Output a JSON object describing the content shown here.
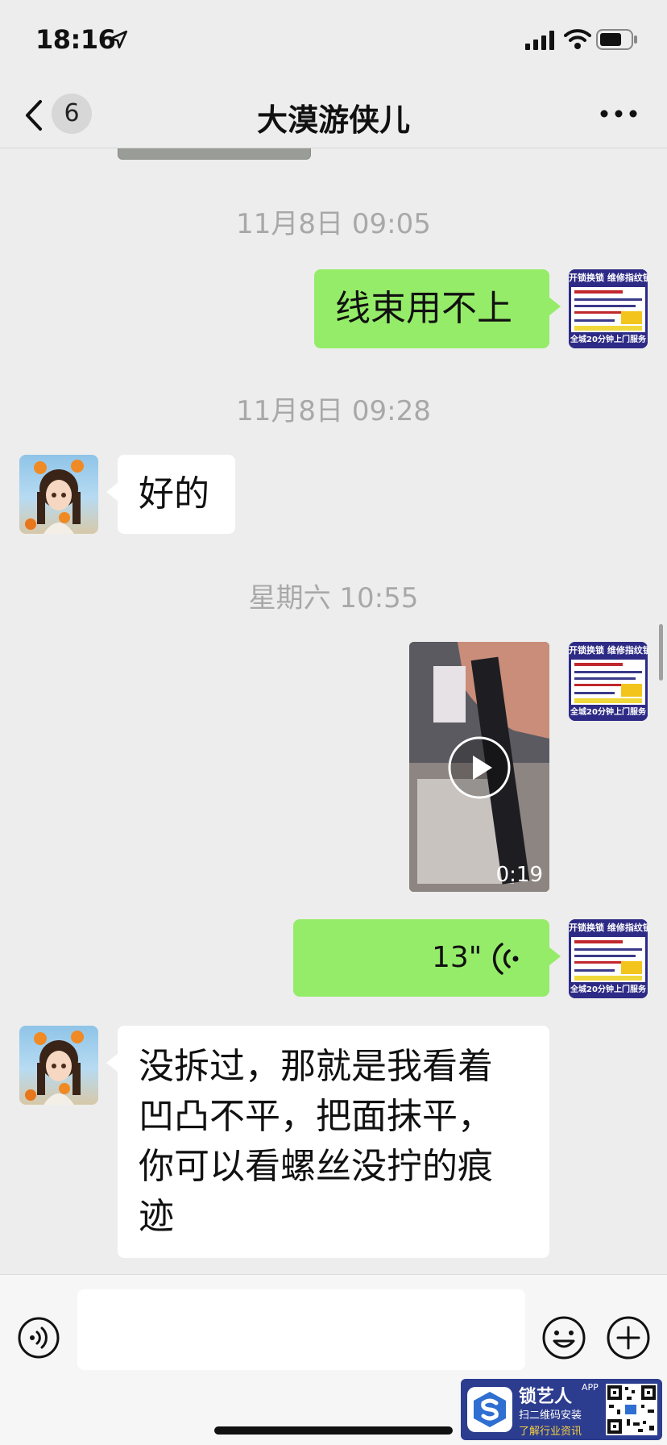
{
  "status_bar": {
    "time": "18:16"
  },
  "nav": {
    "unread_count": "6",
    "title": "大漠游侠儿"
  },
  "messages": [
    {
      "type": "timestamp",
      "text": "11月8日 09:05"
    },
    {
      "type": "text",
      "direction": "out",
      "text": "线束用不上"
    },
    {
      "type": "timestamp",
      "text": "11月8日 09:28"
    },
    {
      "type": "text",
      "direction": "in",
      "text": "好的"
    },
    {
      "type": "timestamp",
      "text": "星期六 10:55"
    },
    {
      "type": "video",
      "direction": "out",
      "duration": "0:19"
    },
    {
      "type": "voice",
      "direction": "out",
      "duration": "13\""
    },
    {
      "type": "text",
      "direction": "in",
      "text": "没拆过，那就是我看着凹凸不平，把面抹平，你可以看螺丝没拧的痕迹",
      "lines": [
        "没拆过，那就是我看着",
        "凹凸不平，把面抹平，",
        "你可以看螺丝没拧的痕",
        "迹"
      ]
    }
  ],
  "shop_avatar": {
    "top_text": "开锁换锁  维修指纹锁",
    "bottom_text": "全城20分钟上门服务"
  },
  "input_bar": {
    "placeholder": ""
  },
  "watermark": {
    "name": "锁艺人",
    "app": "APP",
    "line1": "扫二维码安装",
    "line2": "了解行业资讯"
  },
  "colors": {
    "background": "#ededed",
    "outgoing_bubble": "#95ec69",
    "incoming_bubble": "#ffffff",
    "timestamp": "#a8a8a8"
  }
}
